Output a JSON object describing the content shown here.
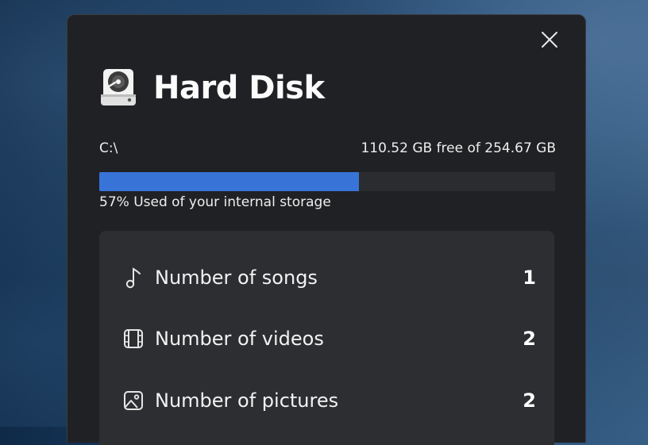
{
  "dialog": {
    "title": "Hard Disk",
    "close_icon": "close-icon",
    "disk_icon": "hard-disk-icon"
  },
  "drive": {
    "letter": "C:\\",
    "free_text": "110.52 GB free of 254.67 GB",
    "used_fraction": 0.57,
    "used_text": "57% Used of your internal storage",
    "bar_color": "#3874d8"
  },
  "stats": [
    {
      "icon": "music-note-icon",
      "label": "Number of songs",
      "value": "1"
    },
    {
      "icon": "film-icon",
      "label": "Number of videos",
      "value": "2"
    },
    {
      "icon": "image-icon",
      "label": "Number of pictures",
      "value": "2"
    }
  ]
}
